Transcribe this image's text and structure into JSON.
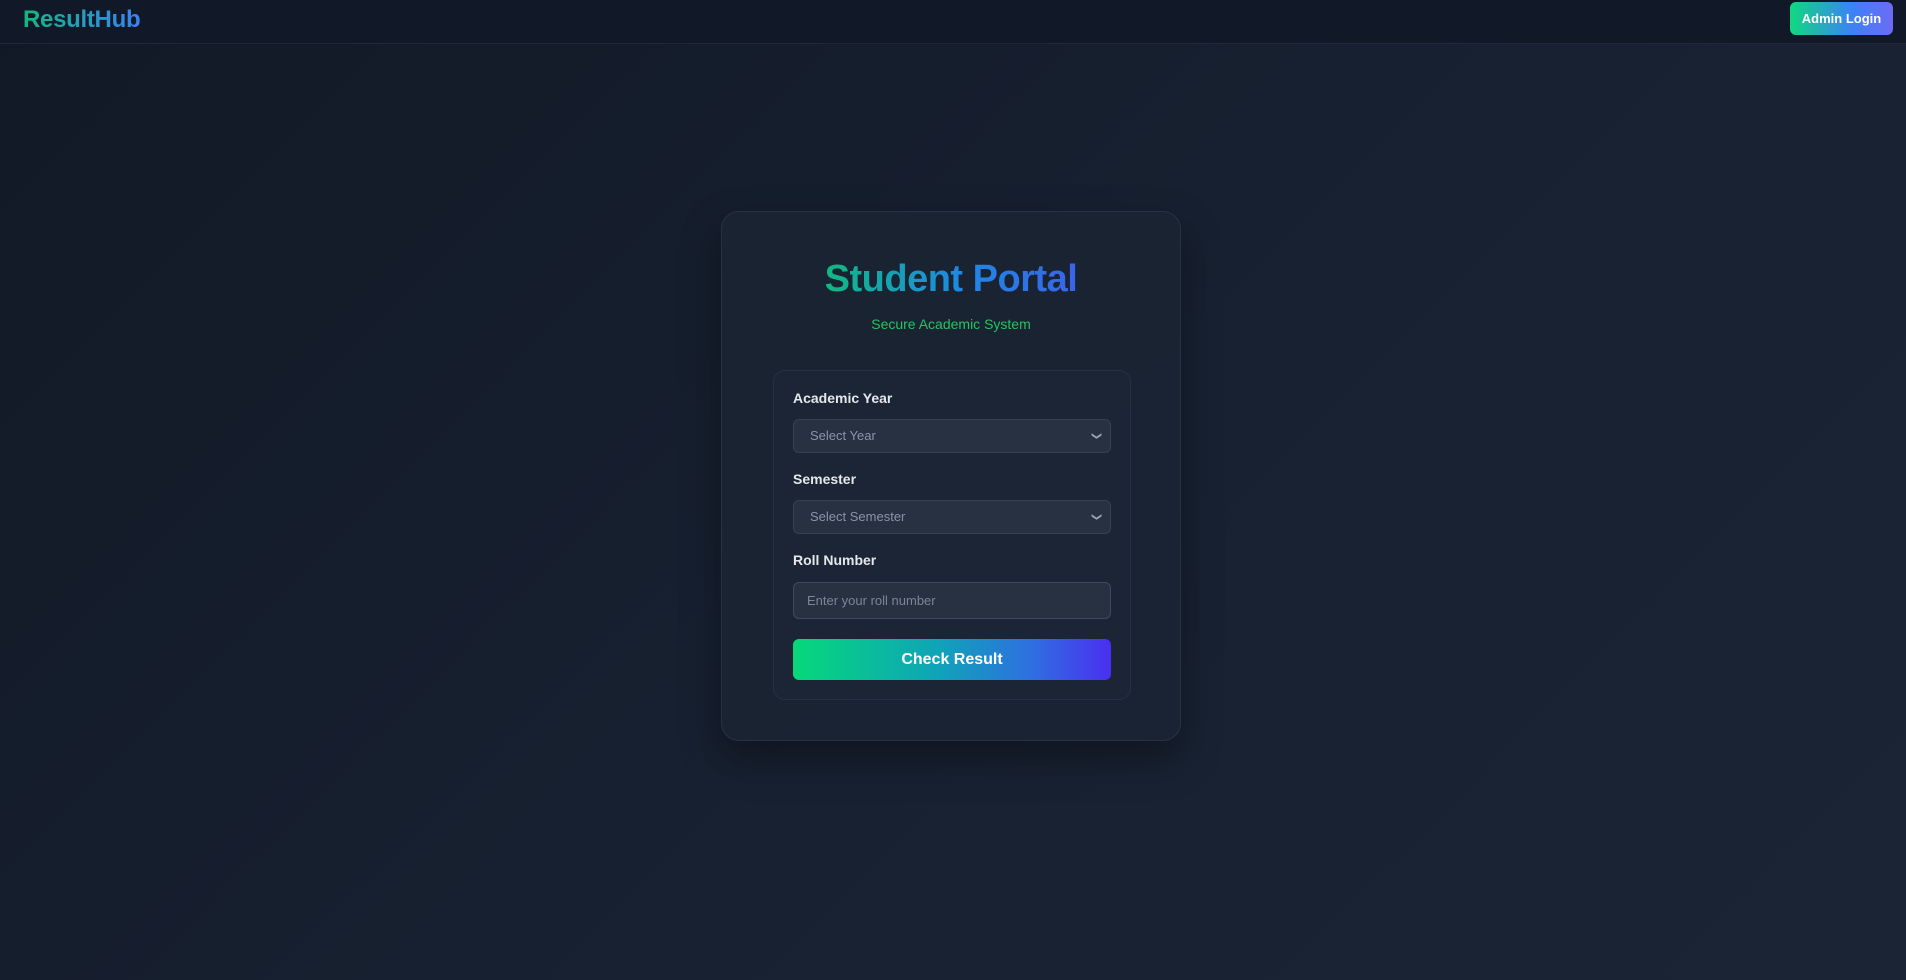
{
  "nav": {
    "brand": "ResultHub",
    "admin_button": "Admin Login"
  },
  "portal": {
    "title": "Student Portal",
    "subtitle": "Secure Academic System"
  },
  "form": {
    "year_label": "Academic Year",
    "year_value": "Select Year",
    "semester_label": "Semester",
    "semester_value": "Select Semester",
    "roll_label": "Roll Number",
    "roll_placeholder": "Enter your roll number",
    "roll_value": "",
    "submit_label": "Check Result"
  },
  "icons": {
    "dropdown": "chevron-down-icon"
  },
  "colors": {
    "background": "#141c29",
    "accent_green": "#10b981",
    "accent_blue": "#3b82f6",
    "accent_indigo": "#4a2ff0",
    "subtitle_green": "#22c55e"
  }
}
